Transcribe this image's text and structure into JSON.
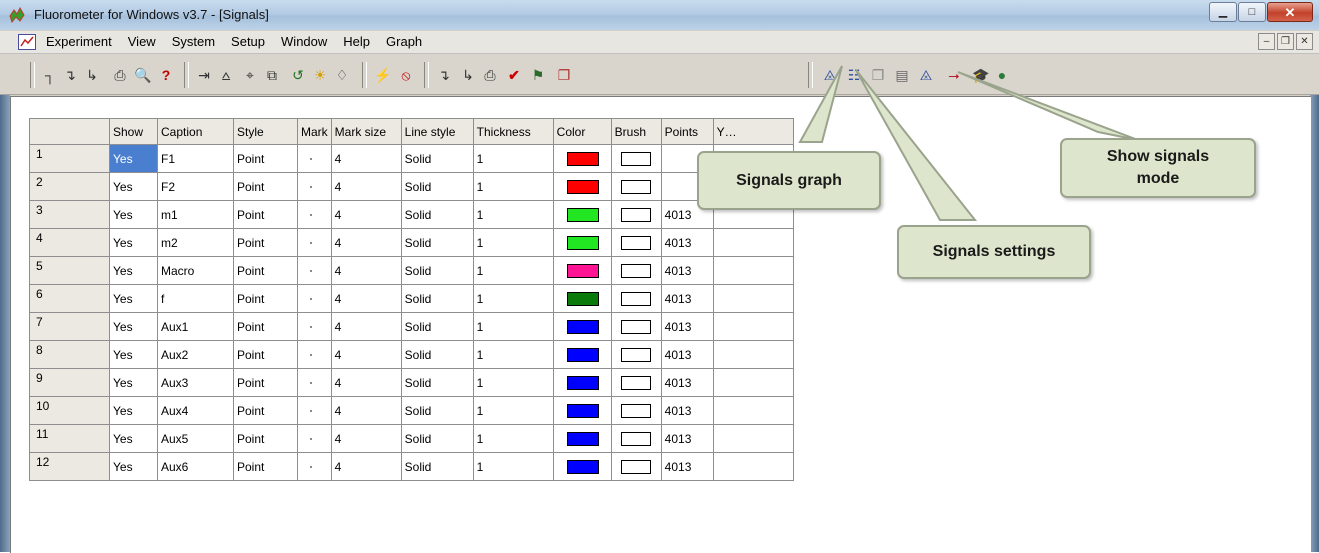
{
  "window": {
    "title": "Fluorometer for Windows v3.7 - [Signals]",
    "controls": [
      "minimize",
      "maximize",
      "close"
    ]
  },
  "menu": {
    "items": [
      "Experiment",
      "View",
      "System",
      "Setup",
      "Window",
      "Help",
      "Graph"
    ]
  },
  "table": {
    "columns": [
      "",
      "Show",
      "Caption",
      "Style",
      "Mark",
      "Mark size",
      "Line style",
      "Thickness",
      "Color",
      "Brush",
      "Points",
      "Y…"
    ],
    "rows": [
      {
        "n": "1",
        "show": "Yes",
        "caption": "F1",
        "style": "Point",
        "mark_size": "4",
        "line_style": "Solid",
        "thickness": "1",
        "color": "#ff0000",
        "points": ""
      },
      {
        "n": "2",
        "show": "Yes",
        "caption": "F2",
        "style": "Point",
        "mark_size": "4",
        "line_style": "Solid",
        "thickness": "1",
        "color": "#ff0000",
        "points": ""
      },
      {
        "n": "3",
        "show": "Yes",
        "caption": "m1",
        "style": "Point",
        "mark_size": "4",
        "line_style": "Solid",
        "thickness": "1",
        "color": "#22e622",
        "points": "4013"
      },
      {
        "n": "4",
        "show": "Yes",
        "caption": "m2",
        "style": "Point",
        "mark_size": "4",
        "line_style": "Solid",
        "thickness": "1",
        "color": "#22e622",
        "points": "4013"
      },
      {
        "n": "5",
        "show": "Yes",
        "caption": "Macro",
        "style": "Point",
        "mark_size": "4",
        "line_style": "Solid",
        "thickness": "1",
        "color": "#ff1493",
        "points": "4013"
      },
      {
        "n": "6",
        "show": "Yes",
        "caption": "f",
        "style": "Point",
        "mark_size": "4",
        "line_style": "Solid",
        "thickness": "1",
        "color": "#0a7a0a",
        "points": "4013"
      },
      {
        "n": "7",
        "show": "Yes",
        "caption": "Aux1",
        "style": "Point",
        "mark_size": "4",
        "line_style": "Solid",
        "thickness": "1",
        "color": "#0000ff",
        "points": "4013"
      },
      {
        "n": "8",
        "show": "Yes",
        "caption": "Aux2",
        "style": "Point",
        "mark_size": "4",
        "line_style": "Solid",
        "thickness": "1",
        "color": "#0000ff",
        "points": "4013"
      },
      {
        "n": "9",
        "show": "Yes",
        "caption": "Aux3",
        "style": "Point",
        "mark_size": "4",
        "line_style": "Solid",
        "thickness": "1",
        "color": "#0000ff",
        "points": "4013"
      },
      {
        "n": "10",
        "show": "Yes",
        "caption": "Aux4",
        "style": "Point",
        "mark_size": "4",
        "line_style": "Solid",
        "thickness": "1",
        "color": "#0000ff",
        "points": "4013"
      },
      {
        "n": "11",
        "show": "Yes",
        "caption": "Aux5",
        "style": "Point",
        "mark_size": "4",
        "line_style": "Solid",
        "thickness": "1",
        "color": "#0000ff",
        "points": "4013"
      },
      {
        "n": "12",
        "show": "Yes",
        "caption": "Aux6",
        "style": "Point",
        "mark_size": "4",
        "line_style": "Solid",
        "thickness": "1",
        "color": "#0000ff",
        "points": "4013"
      }
    ]
  },
  "callouts": {
    "signals_graph": "Signals graph",
    "signals_settings": "Signals settings",
    "show_signals_mode": "Show signals mode"
  }
}
